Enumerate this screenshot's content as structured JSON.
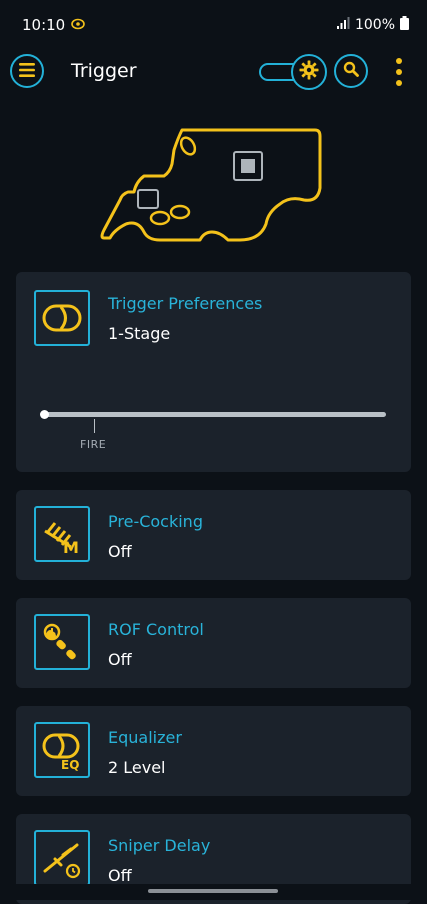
{
  "status_bar": {
    "time": "10:10",
    "battery": "100%"
  },
  "app_bar": {
    "title": "Trigger",
    "menu_icon": "menu-icon",
    "mode_toggle_icon": "gear-icon",
    "search_icon": "search-icon",
    "more_icon": "more-vertical-icon"
  },
  "colors": {
    "accent": "#23b1d8",
    "highlight": "#f4c21b",
    "card_bg": "#1b222b",
    "background": "#0c1117"
  },
  "cards": [
    {
      "title": "Trigger Preferences",
      "value": "1-Stage",
      "icon": "trigger-stage-icon",
      "slider": {
        "label": "FIRE",
        "position": 0.0
      }
    },
    {
      "title": "Pre-Cocking",
      "value": "Off",
      "icon": "spring-mode-icon"
    },
    {
      "title": "ROF Control",
      "value": "Off",
      "icon": "rof-timer-icon"
    },
    {
      "title": "Equalizer",
      "value": "2 Level",
      "icon": "equalizer-icon"
    },
    {
      "title": "Sniper Delay",
      "value": "Off",
      "icon": "sniper-rifle-icon"
    }
  ]
}
